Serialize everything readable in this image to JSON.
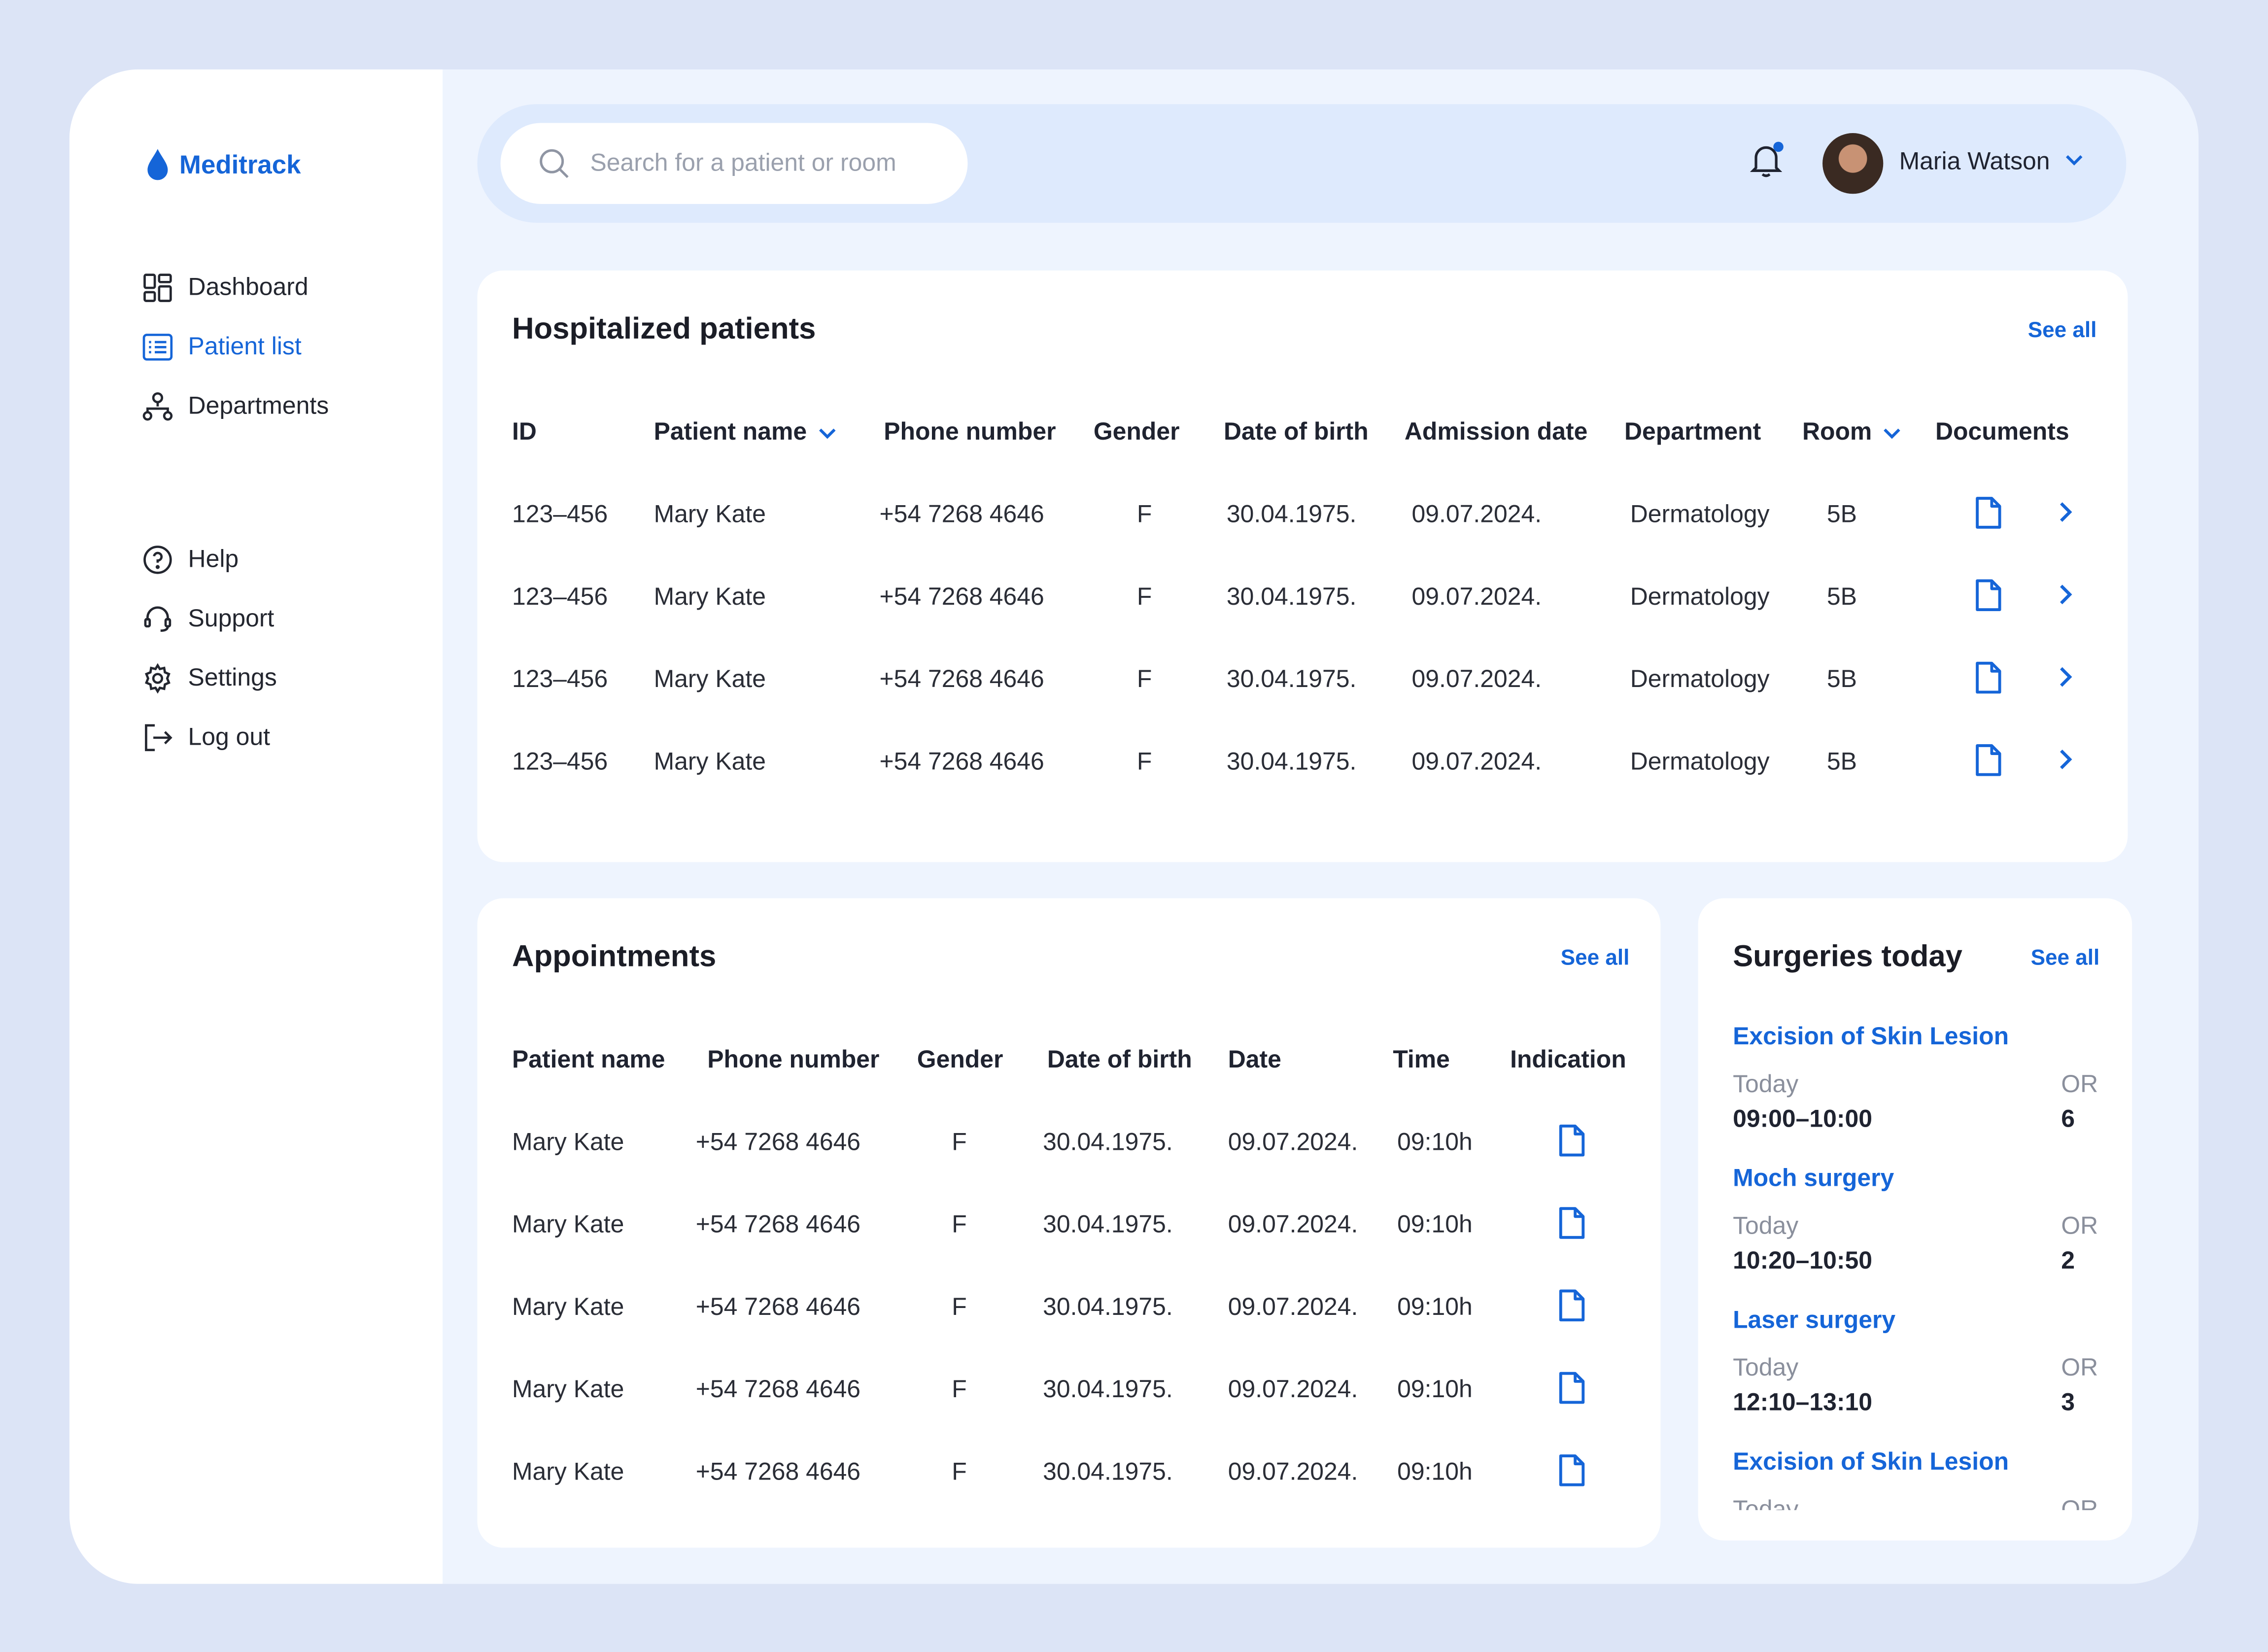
{
  "app": {
    "name": "Meditrack"
  },
  "sidebar": {
    "nav": [
      {
        "label": "Dashboard",
        "icon": "dashboard-icon"
      },
      {
        "label": "Patient list",
        "icon": "list-icon",
        "active": true
      },
      {
        "label": "Departments",
        "icon": "departments-icon"
      }
    ],
    "secondary": [
      {
        "label": "Help",
        "icon": "help-icon"
      },
      {
        "label": "Support",
        "icon": "headset-icon"
      },
      {
        "label": "Settings",
        "icon": "gear-icon"
      },
      {
        "label": "Log out",
        "icon": "logout-icon"
      }
    ]
  },
  "topbar": {
    "search_placeholder": "Search for a patient or room",
    "user_name": "Maria Watson"
  },
  "hospitalized": {
    "title": "Hospitalized patients",
    "see_all": "See all",
    "columns": [
      "ID",
      "Patient name",
      "Phone number",
      "Gender",
      "Date of birth",
      "Admission date",
      "Department",
      "Room",
      "Documents"
    ],
    "rows": [
      {
        "id": "123–456",
        "name": "Mary Kate",
        "phone": "+54 7268 4646",
        "gender": "F",
        "dob": "30.04.1975.",
        "admission": "09.07.2024.",
        "department": "Dermatology",
        "room": "5B"
      },
      {
        "id": "123–456",
        "name": "Mary Kate",
        "phone": "+54 7268 4646",
        "gender": "F",
        "dob": "30.04.1975.",
        "admission": "09.07.2024.",
        "department": "Dermatology",
        "room": "5B"
      },
      {
        "id": "123–456",
        "name": "Mary Kate",
        "phone": "+54 7268 4646",
        "gender": "F",
        "dob": "30.04.1975.",
        "admission": "09.07.2024.",
        "department": "Dermatology",
        "room": "5B"
      },
      {
        "id": "123–456",
        "name": "Mary Kate",
        "phone": "+54 7268 4646",
        "gender": "F",
        "dob": "30.04.1975.",
        "admission": "09.07.2024.",
        "department": "Dermatology",
        "room": "5B"
      }
    ]
  },
  "appointments": {
    "title": "Appointments",
    "see_all": "See all",
    "columns": [
      "Patient name",
      "Phone number",
      "Gender",
      "Date of birth",
      "Date",
      "Time",
      "Indication"
    ],
    "rows": [
      {
        "name": "Mary Kate",
        "phone": "+54 7268 4646",
        "gender": "F",
        "dob": "30.04.1975.",
        "date": "09.07.2024.",
        "time": "09:10h"
      },
      {
        "name": "Mary Kate",
        "phone": "+54 7268 4646",
        "gender": "F",
        "dob": "30.04.1975.",
        "date": "09.07.2024.",
        "time": "09:10h"
      },
      {
        "name": "Mary Kate",
        "phone": "+54 7268 4646",
        "gender": "F",
        "dob": "30.04.1975.",
        "date": "09.07.2024.",
        "time": "09:10h"
      },
      {
        "name": "Mary Kate",
        "phone": "+54 7268 4646",
        "gender": "F",
        "dob": "30.04.1975.",
        "date": "09.07.2024.",
        "time": "09:10h"
      },
      {
        "name": "Mary Kate",
        "phone": "+54 7268 4646",
        "gender": "F",
        "dob": "30.04.1975.",
        "date": "09.07.2024.",
        "time": "09:10h"
      }
    ]
  },
  "surgeries": {
    "title": "Surgeries today",
    "see_all": "See all",
    "items": [
      {
        "name": "Excision of Skin Lesion",
        "day": "Today",
        "time": "09:00–10:00",
        "or_label": "OR",
        "or_number": "6"
      },
      {
        "name": "Moch surgery",
        "day": "Today",
        "time": "10:20–10:50",
        "or_label": "OR",
        "or_number": "2"
      },
      {
        "name": "Laser surgery",
        "day": "Today",
        "time": "12:10–13:10",
        "or_label": "OR",
        "or_number": "3"
      },
      {
        "name": "Excision of Skin Lesion",
        "day": "Today",
        "time": "",
        "or_label": "OR",
        "or_number": ""
      }
    ]
  },
  "colors": {
    "accent": "#1565d8",
    "page_bg": "#dce4f6",
    "app_bg": "#eef4fe",
    "topbar_bg": "#deeafd"
  }
}
